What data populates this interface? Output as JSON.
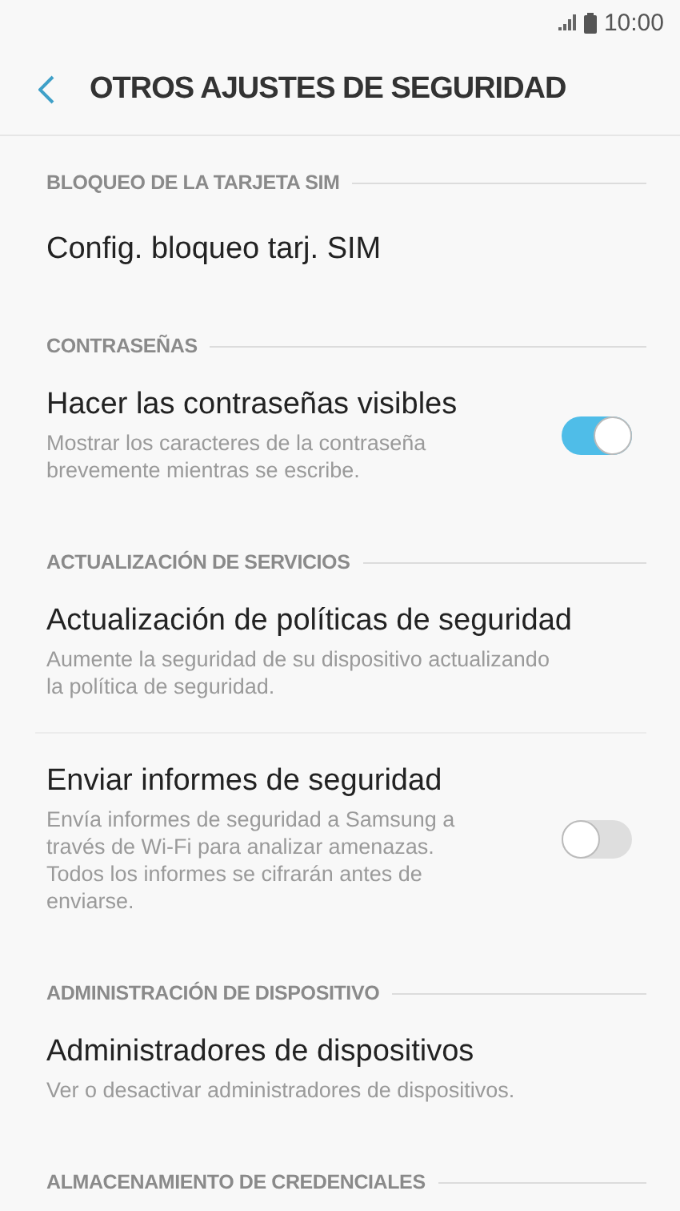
{
  "status_bar": {
    "time": "10:00"
  },
  "header": {
    "title": "OTROS AJUSTES DE SEGURIDAD"
  },
  "sections": [
    {
      "title": "BLOQUEO DE LA TARJETA SIM",
      "items": [
        {
          "kind": "link",
          "title": "Config. bloqueo tarj. SIM"
        }
      ]
    },
    {
      "title": "CONTRASEÑAS",
      "items": [
        {
          "kind": "switch",
          "title": "Hacer las contraseñas visibles",
          "subtitle": "Mostrar los caracteres de la contraseña brevemente mientras se escribe.",
          "on": true
        }
      ]
    },
    {
      "title": "ACTUALIZACIÓN DE SERVICIOS",
      "items": [
        {
          "kind": "link",
          "title": "Actualización de políticas de seguridad",
          "subtitle": "Aumente la seguridad de su dispositivo actualizando la política de seguridad."
        },
        {
          "kind": "switch",
          "title": "Enviar informes de seguridad",
          "subtitle": "Envía informes de seguridad a Samsung a través de Wi-Fi para analizar amenazas. Todos los informes se cifrarán antes de enviarse.",
          "on": false
        }
      ]
    },
    {
      "title": "ADMINISTRACIÓN DE DISPOSITIVO",
      "items": [
        {
          "kind": "link",
          "title": "Administradores de dispositivos",
          "subtitle": "Ver o desactivar administradores de dispositivos."
        }
      ]
    },
    {
      "title": "ALMACENAMIENTO DE CREDENCIALES"
    }
  ]
}
